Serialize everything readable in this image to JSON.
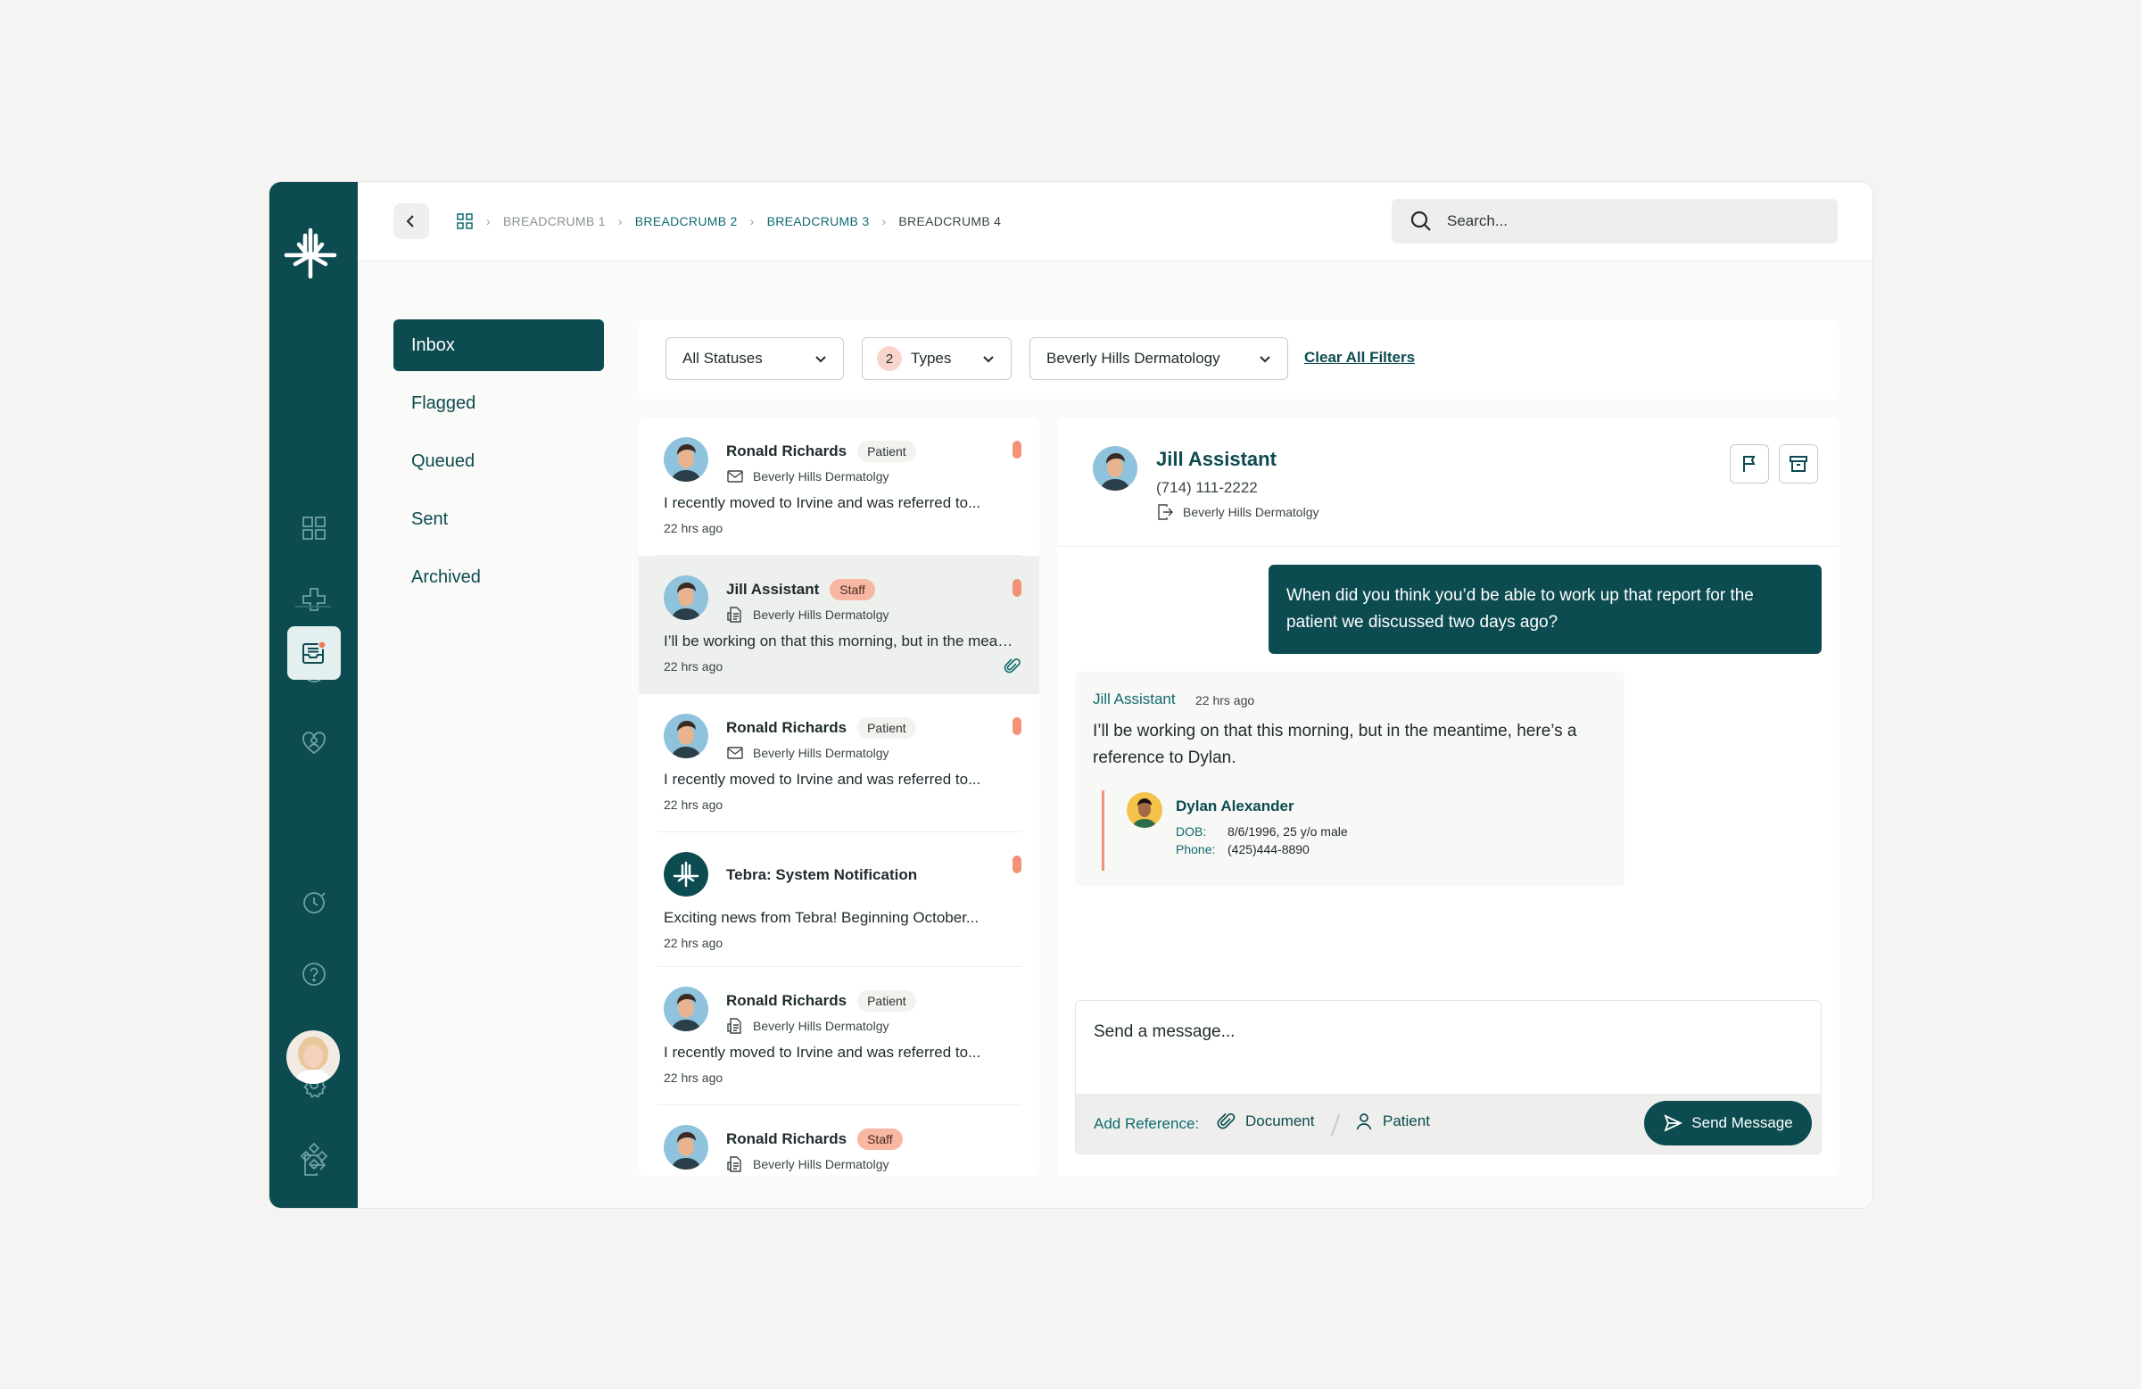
{
  "breadcrumbs": [
    "BREADCRUMB 1",
    "BREADCRUMB 2",
    "BREADCRUMB 3",
    "BREADCRUMB 4"
  ],
  "search": {
    "placeholder": "Search..."
  },
  "folders": [
    "Inbox",
    "Flagged",
    "Queued",
    "Sent",
    "Archived"
  ],
  "filters": {
    "status": "All Statuses",
    "types_count": "2",
    "types_label": "Types",
    "location": "Beverly Hills Dermatology",
    "clear": "Clear All Filters"
  },
  "messages": [
    {
      "name": "Ronald Richards",
      "tag": "Patient",
      "org": "Beverly Hills Dermatolgy",
      "preview": "I recently moved to Irvine and was referred to...",
      "time": "22 hrs ago"
    },
    {
      "name": "Jill Assistant",
      "tag": "Staff",
      "org": "Beverly Hills Dermatolgy",
      "preview": "I’ll be working on that this morning, but in the meantime...",
      "time": "22 hrs ago"
    },
    {
      "name": "Ronald Richards",
      "tag": "Patient",
      "org": "Beverly Hills Dermatolgy",
      "preview": "I recently moved to Irvine and was referred to...",
      "time": "22 hrs ago"
    },
    {
      "name": "Tebra: System Notification",
      "preview": "Exciting news from Tebra! Beginning October...",
      "time": "22 hrs ago"
    },
    {
      "name": "Ronald Richards",
      "tag": "Patient",
      "org": "Beverly Hills Dermatolgy",
      "preview": "I recently moved to Irvine and was referred to...",
      "time": "22 hrs ago"
    },
    {
      "name": "Ronald Richards",
      "tag": "Staff",
      "org": "Beverly Hills Dermatolgy"
    }
  ],
  "conversation": {
    "name": "Jill Assistant",
    "phone": "(714) 111-2222",
    "org": "Beverly Hills Dermatolgy",
    "outgoing": "When did you think you’d be able to work up that report for the patient we discussed two days ago?",
    "incoming_sender": "Jill Assistant",
    "incoming_time": "22 hrs ago",
    "incoming_body": "I’ll be working on that this morning, but in the meantime, here’s a reference to Dylan.",
    "reference": {
      "name": "Dylan Alexander",
      "dob_label": "DOB:",
      "dob": "8/6/1996, 25 y/o male",
      "phone_label": "Phone:",
      "phone": "(425)444-8890"
    }
  },
  "composer": {
    "placeholder": "Send a message...",
    "add_reference": "Add Reference:",
    "document": "Document",
    "patient": "Patient",
    "send": "Send Message"
  },
  "colors": {
    "primary": "#0c4b50",
    "accent": "#f29378",
    "staff_tag": "#f7b7a3"
  }
}
